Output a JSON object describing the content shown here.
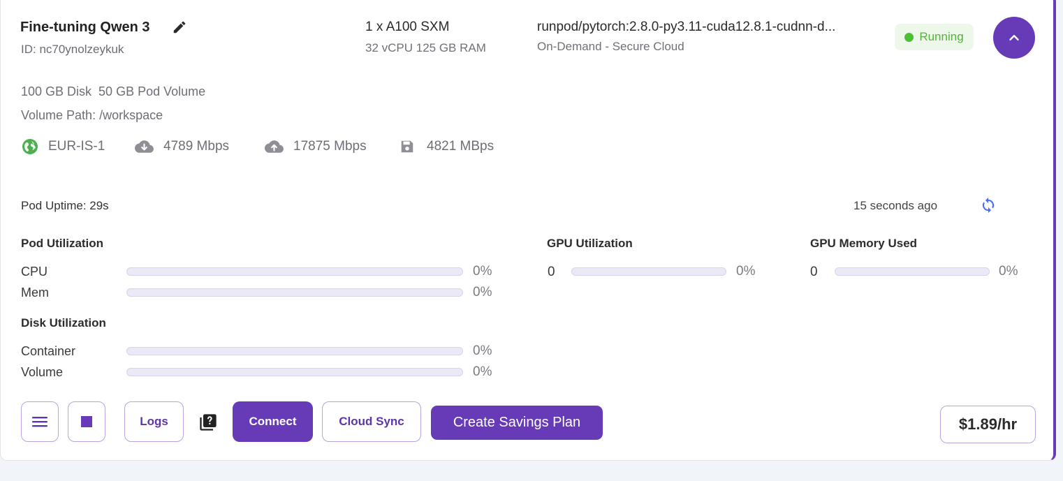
{
  "pod": {
    "name": "Fine-tuning Qwen 3",
    "id_text": "ID: nc70ynolzeykuk",
    "gpu": "1 x A100 SXM",
    "specs": "32 vCPU 125 GB RAM",
    "image": "runpod/pytorch:2.8.0-py3.11-cuda12.8.1-cudnn-d...",
    "cloud": "On-Demand - Secure Cloud",
    "status": "Running",
    "disk": "100 GB Disk",
    "pod_volume": "50 GB Pod Volume",
    "volume_path": "Volume Path: /workspace"
  },
  "network": {
    "region": "EUR-IS-1",
    "download": "4789 Mbps",
    "upload": "17875 Mbps",
    "disk_speed": "4821 MBps"
  },
  "uptime": "Pod Uptime: 29s",
  "last_updated": "15 seconds ago",
  "utilization": {
    "pod_title": "Pod Utilization",
    "cpu": {
      "label": "CPU",
      "pct_text": "0%",
      "value": 0
    },
    "mem": {
      "label": "Mem",
      "pct_text": "0%",
      "value": 0
    },
    "disk_title": "Disk Utilization",
    "container": {
      "label": "Container",
      "pct_text": "0%",
      "value": 0
    },
    "volume": {
      "label": "Volume",
      "pct_text": "0%",
      "value": 0
    },
    "gpu_title": "GPU Utilization",
    "gpu": {
      "index": "0",
      "pct_text": "0%",
      "value": 0
    },
    "gpu_mem_title": "GPU Memory Used",
    "gpu_mem": {
      "index": "0",
      "pct_text": "0%",
      "value": 0
    }
  },
  "actions": {
    "logs": "Logs",
    "connect": "Connect",
    "cloud_sync": "Cloud Sync",
    "savings_plan": "Create Savings Plan"
  },
  "price": "$1.89/hr",
  "colors": {
    "accent": "#673ab7",
    "running": "#4cbf35",
    "globe": "#4caf50"
  }
}
